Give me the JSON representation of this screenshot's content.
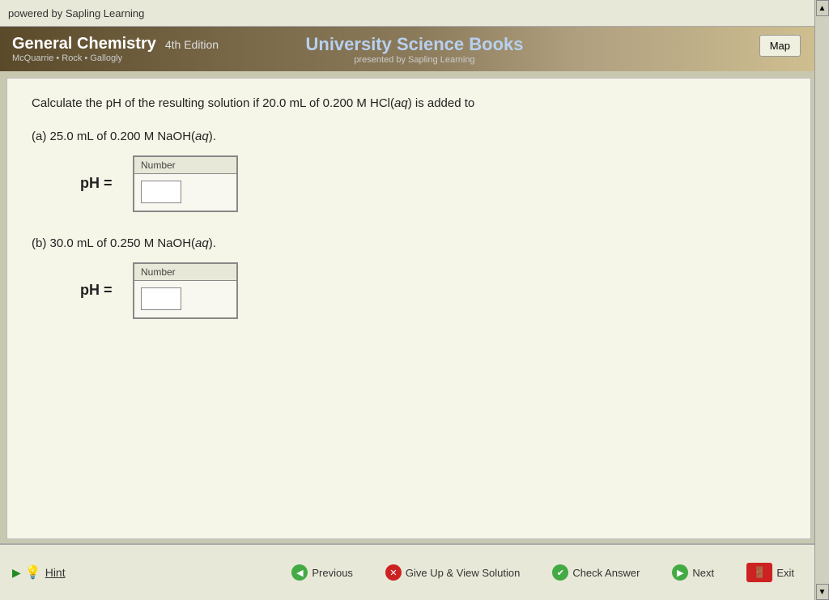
{
  "topbar": {
    "text": "powered by Sapling Learning"
  },
  "header": {
    "title": "General Chemistry",
    "edition": "4th Edition",
    "authors": "McQuarrie • Rock • Gallogly",
    "publisher_name": "University Science Books",
    "publisher_sub": "presented by Sapling Learning",
    "map_button": "Map"
  },
  "question": {
    "text": "Calculate the pH of the resulting solution if 20.0 mL of 0.200 M HCl(aq) is added to",
    "part_a": {
      "label": "(a) 25.0 mL of 0.200 M NaOH(aq).",
      "ph_label": "pH =",
      "input_label": "Number",
      "input_value": ""
    },
    "part_b": {
      "label": "(b) 30.0 mL of 0.250 M NaOH(aq).",
      "ph_label": "pH =",
      "input_label": "Number",
      "input_value": ""
    }
  },
  "bottom": {
    "hint_label": "Hint",
    "previous_label": "Previous",
    "give_up_label": "Give Up & View Solution",
    "check_answer_label": "Check Answer",
    "next_label": "Next",
    "exit_label": "Exit"
  },
  "scrollbar": {
    "up_arrow": "▲",
    "down_arrow": "▼"
  }
}
